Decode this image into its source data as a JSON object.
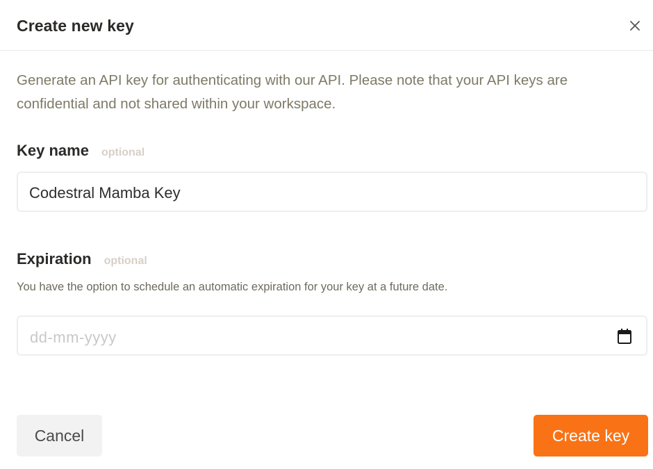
{
  "dialog": {
    "title": "Create new key",
    "description": "Generate an API key for authenticating with our API. Please note that your API keys are confidential and not shared within your workspace."
  },
  "key_name": {
    "label": "Key name",
    "optional": "optional",
    "value": "Codestral Mamba Key"
  },
  "expiration": {
    "label": "Expiration",
    "optional": "optional",
    "hint": "You have the option to schedule an automatic expiration for your key at a future date.",
    "placeholder": "dd-mm-yyyy"
  },
  "buttons": {
    "cancel": "Cancel",
    "create": "Create key"
  },
  "icons": {
    "close": "close-icon",
    "calendar": "calendar-icon"
  },
  "colors": {
    "accent": "#f97316"
  }
}
